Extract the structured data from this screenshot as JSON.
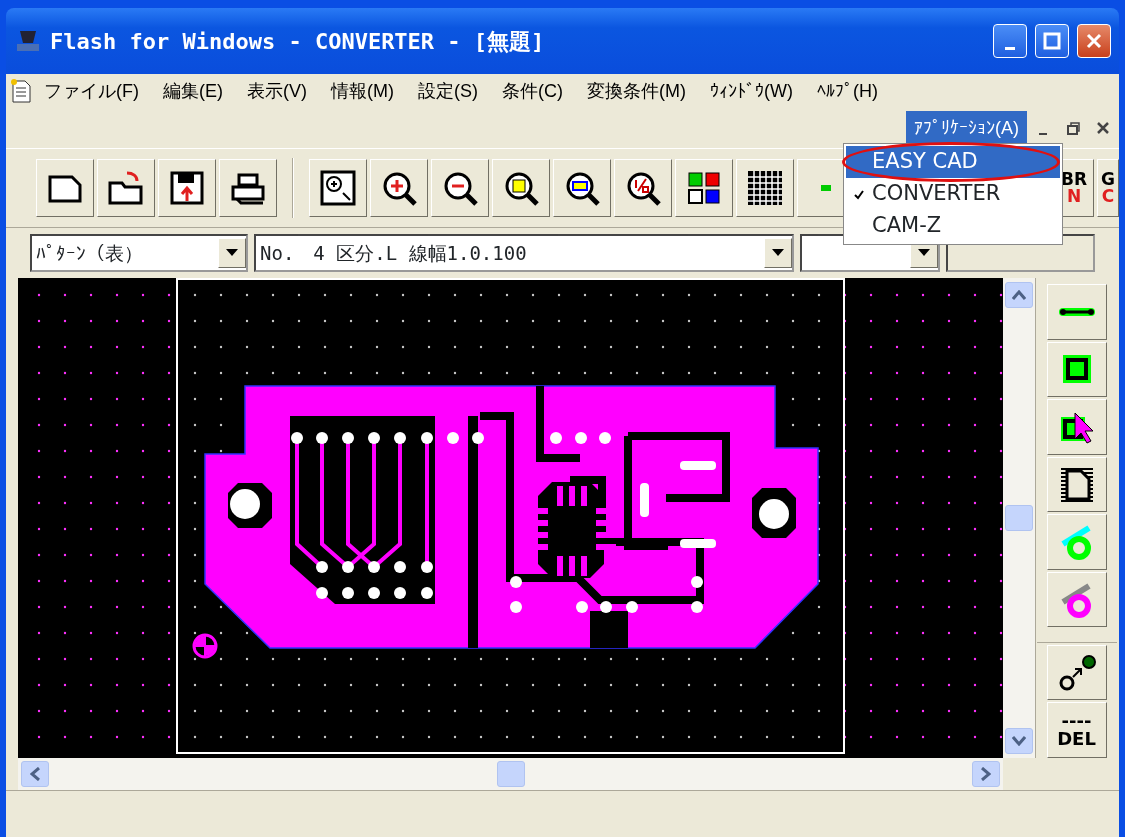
{
  "window": {
    "title": "Flash for Windows - CONVERTER - [無題]"
  },
  "menu": [
    {
      "label": "ファイル(F)"
    },
    {
      "label": "編集(E)"
    },
    {
      "label": "表示(V)"
    },
    {
      "label": "情報(M)"
    },
    {
      "label": "設定(S)"
    },
    {
      "label": "条件(C)"
    },
    {
      "label": "変換条件(M)"
    },
    {
      "label": "ｳｨﾝﾄﾞｳ(W)"
    },
    {
      "label": "ﾍﾙﾌﾟ(H)"
    }
  ],
  "app_menu": {
    "label": "ｱﾌﾟﾘｹｰｼｮﾝ(A)",
    "selected": true,
    "items": [
      {
        "label": "EASY CAD",
        "selected": true,
        "checked": false,
        "circled": true
      },
      {
        "label": "CONVERTER",
        "selected": false,
        "checked": true,
        "circled": false
      },
      {
        "label": "CAM-Z",
        "selected": false,
        "checked": false,
        "circled": false
      }
    ]
  },
  "toolbar": [
    {
      "kind": "new"
    },
    {
      "kind": "open"
    },
    {
      "kind": "save"
    },
    {
      "kind": "print"
    },
    {
      "kind": "sep"
    },
    {
      "kind": "zoom-window"
    },
    {
      "kind": "zoom-in"
    },
    {
      "kind": "zoom-out"
    },
    {
      "kind": "zoom-yellow"
    },
    {
      "kind": "zoom-blue"
    },
    {
      "kind": "zoom-half"
    },
    {
      "kind": "colors"
    },
    {
      "kind": "grid"
    },
    {
      "kind": "hidden"
    },
    {
      "kind": "text",
      "top": "BR",
      "bottom": "N"
    },
    {
      "kind": "text",
      "top": "G",
      "bottom": "C"
    }
  ],
  "selectors": [
    {
      "value": "ﾊﾟﾀｰﾝ（表）"
    },
    {
      "value": "No.　4 区分.L 線幅1.0.100"
    }
  ],
  "palette": [
    {
      "kind": "line"
    },
    {
      "kind": "rect"
    },
    {
      "kind": "select"
    },
    {
      "kind": "layer"
    },
    {
      "kind": "pad-cyan"
    },
    {
      "kind": "pad-magenta"
    },
    {
      "kind": "gap"
    },
    {
      "kind": "move"
    },
    {
      "kind": "del",
      "top": "----",
      "bottom": "DEL"
    }
  ]
}
